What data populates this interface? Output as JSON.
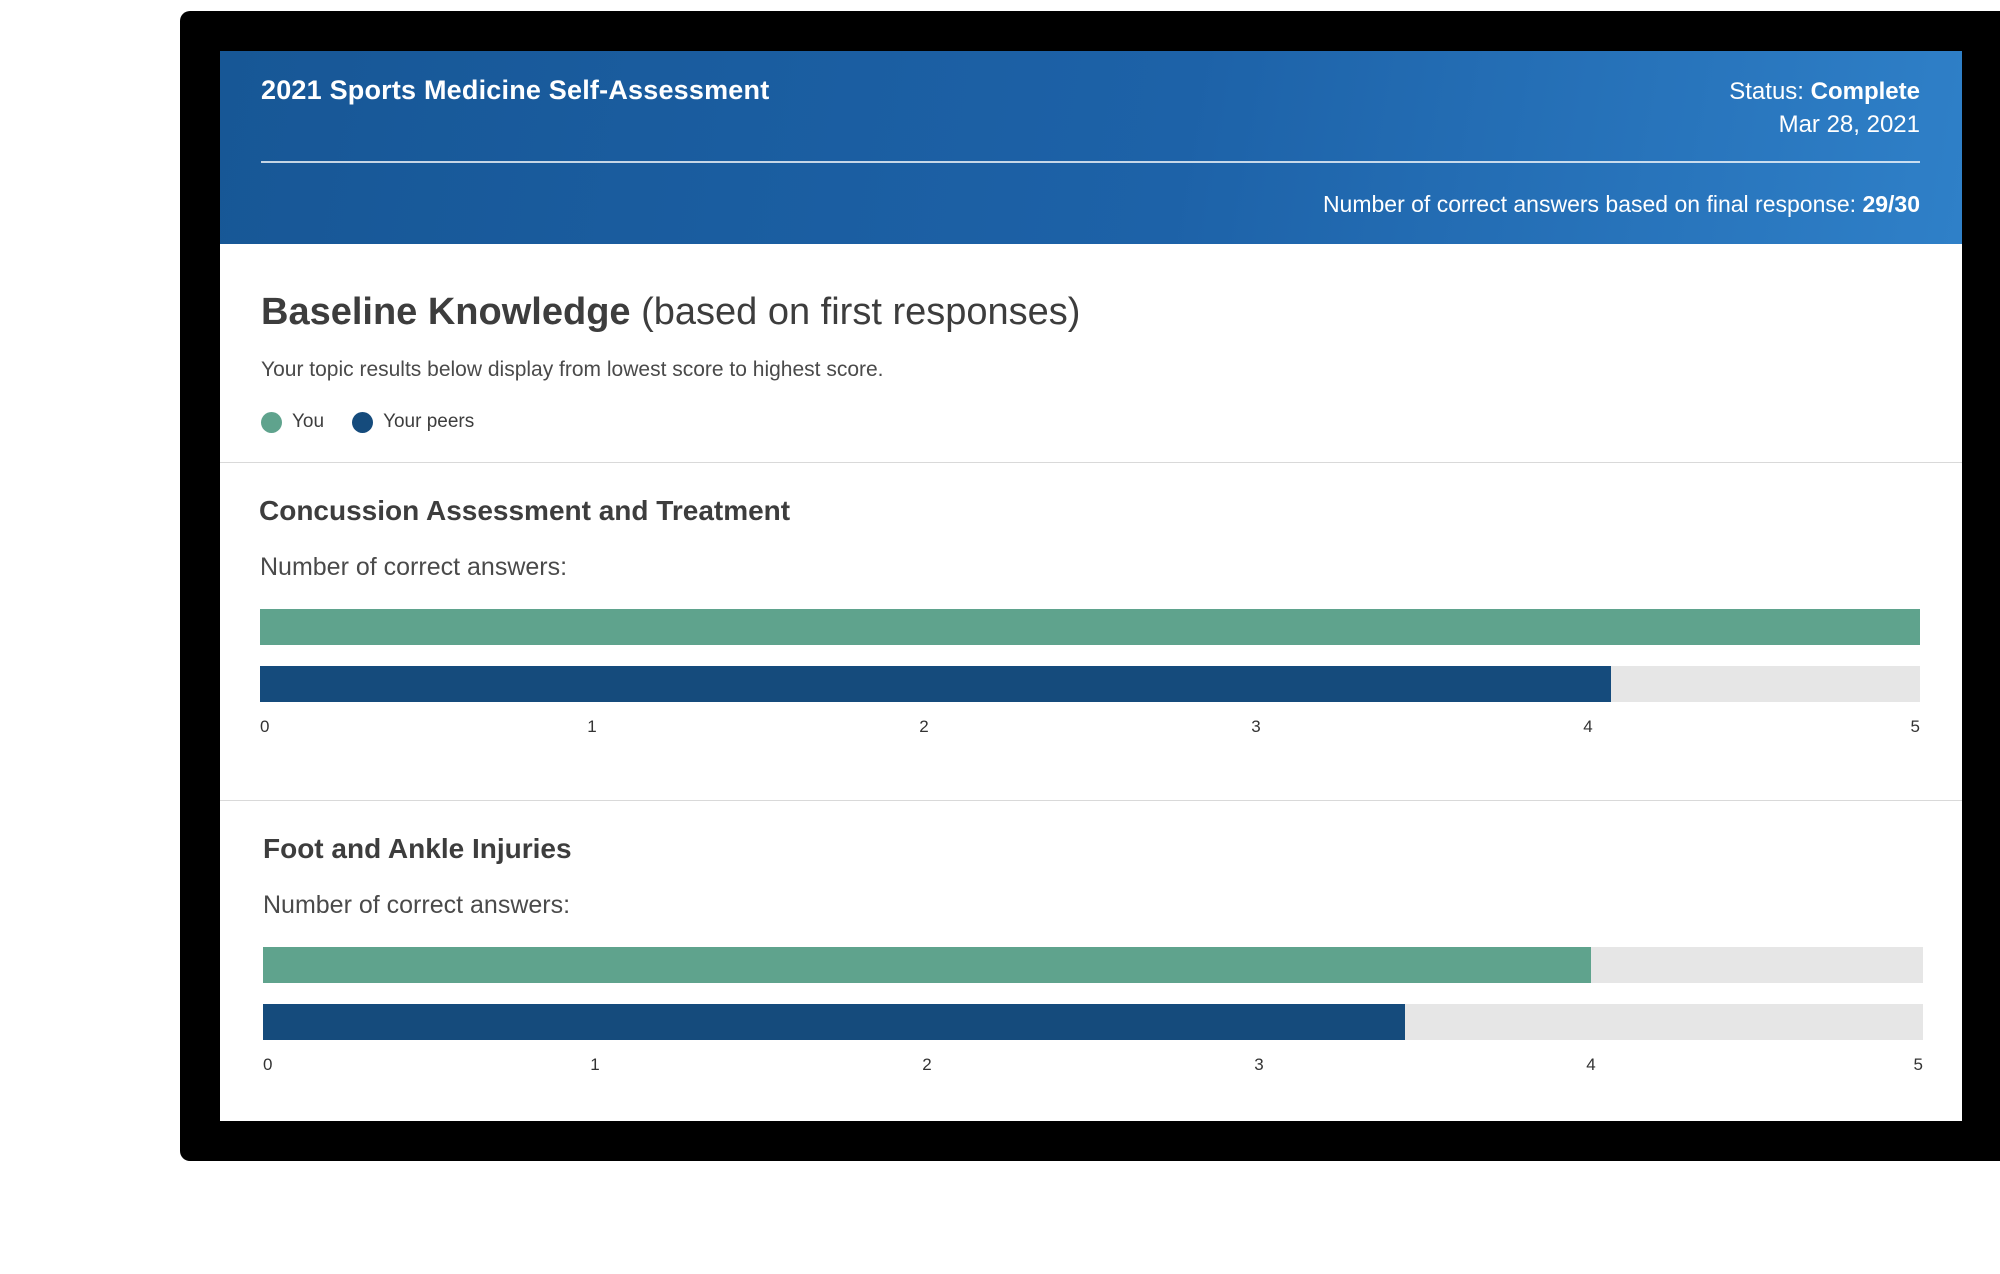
{
  "colors": {
    "you": "#5fa38d",
    "peers": "#154b7c",
    "track": "#e6e6e6",
    "header_start": "#175796",
    "header_end": "#2f80c8"
  },
  "header": {
    "title": "2021 Sports Medicine Self-Assessment",
    "status_label": "Status:",
    "status_value": "Complete",
    "date": "Mar 28, 2021",
    "summary_label": "Number of correct answers based on final response:",
    "summary_value": "29/30"
  },
  "baseline": {
    "title": "Baseline Knowledge",
    "title_suffix": "(based on first responses)",
    "subtitle": "Your topic results below display from lowest score to highest score.",
    "legend": [
      {
        "label": "You",
        "color": "#5fa38d"
      },
      {
        "label": "Your peers",
        "color": "#154b7c"
      }
    ]
  },
  "chart_data": [
    {
      "type": "bar",
      "title": "Concussion Assessment and Treatment",
      "ylabel": "Number of correct answers:",
      "xlim": [
        0,
        5
      ],
      "ticks": [
        "0",
        "1",
        "2",
        "3",
        "4",
        "5"
      ],
      "series": [
        {
          "name": "You",
          "value": 5.0
        },
        {
          "name": "Your peers",
          "value": 4.07
        }
      ]
    },
    {
      "type": "bar",
      "title": "Foot and Ankle Injuries",
      "ylabel": "Number of correct answers:",
      "xlim": [
        0,
        5
      ],
      "ticks": [
        "0",
        "1",
        "2",
        "3",
        "4",
        "5"
      ],
      "series": [
        {
          "name": "You",
          "value": 4.0
        },
        {
          "name": "Your peers",
          "value": 3.44
        }
      ]
    }
  ]
}
